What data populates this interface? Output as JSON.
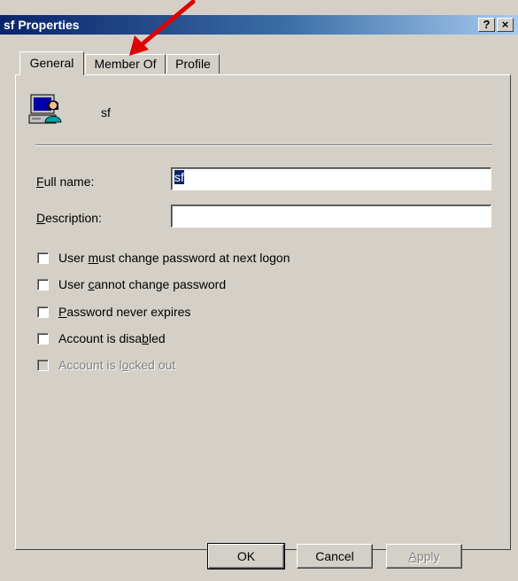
{
  "window": {
    "title": "sf Properties",
    "help_label": "?",
    "close_label": "×",
    "colors": {
      "titlebar_start": "#0a246a",
      "titlebar_end": "#a6caf0",
      "face": "#d4d0c8",
      "annotation_arrow": "#e00000"
    }
  },
  "tabs": [
    {
      "label": "General",
      "selected": true
    },
    {
      "label": "Member Of",
      "selected": false
    },
    {
      "label": "Profile",
      "selected": false
    }
  ],
  "general": {
    "user_icon": "user-computer-icon",
    "user_name": "sf",
    "full_name_label_accel": "F",
    "full_name_label_rest": "ull name:",
    "full_name_value": "sf",
    "description_label_accel": "D",
    "description_label_rest": "escription:",
    "description_value": ""
  },
  "checkboxes": [
    {
      "pre": "User ",
      "accel": "m",
      "post": "ust change password at next logon",
      "checked": false,
      "enabled": true
    },
    {
      "pre": "User ",
      "accel": "c",
      "post": "annot change password",
      "checked": false,
      "enabled": true
    },
    {
      "pre": "",
      "accel": "P",
      "post": "assword never expires",
      "checked": false,
      "enabled": true
    },
    {
      "pre": "Account is disa",
      "accel": "b",
      "post": "led",
      "checked": false,
      "enabled": true
    },
    {
      "pre": "Account is l",
      "accel": "o",
      "post": "cked out",
      "checked": false,
      "enabled": false
    }
  ],
  "buttons": {
    "ok": "OK",
    "cancel": "Cancel",
    "apply_accel": "A",
    "apply_rest": "pply"
  }
}
